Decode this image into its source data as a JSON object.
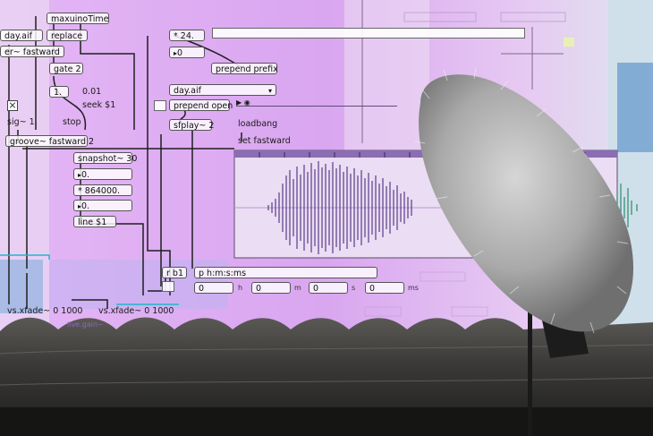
{
  "colors": {
    "background_violet": "#d9a8f0",
    "waveform": "#5b3c8a",
    "waveform_right": "#2d8a6a",
    "roof": "#2e2e2e",
    "sky": "#c9d6dc",
    "windscreen": "#b7b7b7"
  },
  "objects": {
    "maxuinotime": "maxuinoTime",
    "replace": "replace",
    "day_aif_top": "day.aif",
    "fastward_msg": "er~ fastward",
    "gate": "gate 2",
    "num_one": "1.",
    "num_point01": "0.01",
    "seek": "seek $1",
    "sig": "sig~ 1.",
    "stop": "stop",
    "groove": "groove~ fastward 2",
    "snapshot": "snapshot~ 30",
    "num_zero": "0.",
    "mult": "* 864000.",
    "num_zero_2": "0.",
    "line": "line $1",
    "mult_24": "* 24.",
    "num_0": "0",
    "prepend_prefix": "prepend prefix",
    "day_aif_menu": "day.aif",
    "prepend_open": "prepend open",
    "sfplay": "sfplay~ 2",
    "loadbang": "loadbang",
    "set_fastward": "set fastward",
    "rb1": "r b1",
    "phms": "p h:m:s:ms",
    "field_h": "0",
    "field_m": "0",
    "field_s": "0",
    "field_ms": "0",
    "unit_h": "h",
    "unit_m": "m",
    "unit_s": "s",
    "unit_ms": "ms",
    "xfade_1": "vs.xfade~ 0 1000",
    "xfade_2": "vs.xfade~ 0 1000",
    "gain": "live.gain~"
  }
}
